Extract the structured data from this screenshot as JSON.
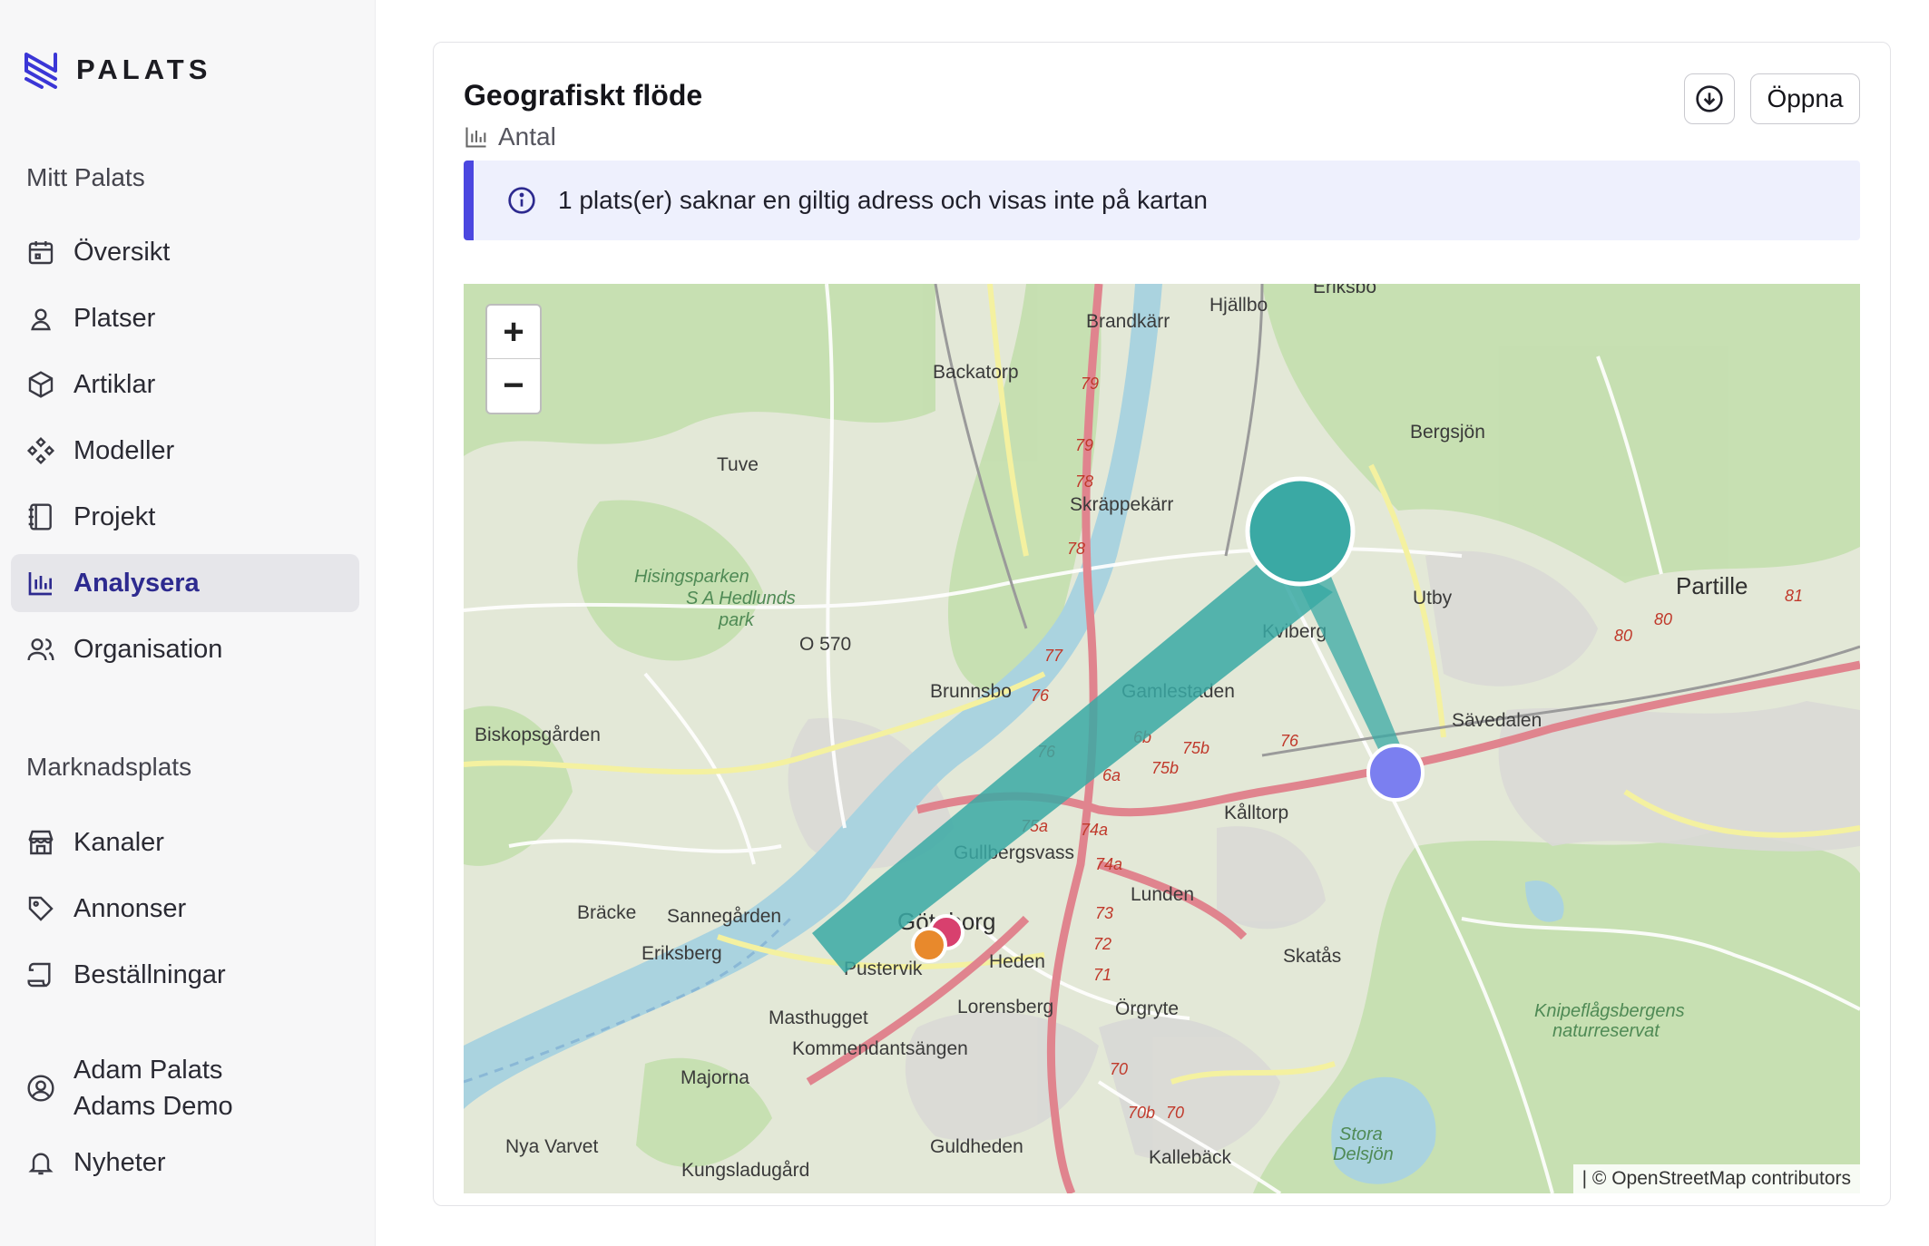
{
  "brand": {
    "name": "PALATS",
    "accent": "#3b36d6"
  },
  "sidebar": {
    "section_main": "Mitt Palats",
    "items": [
      {
        "label": "Översikt",
        "icon": "calendar-icon"
      },
      {
        "label": "Platser",
        "icon": "map-pin-icon"
      },
      {
        "label": "Artiklar",
        "icon": "box-icon"
      },
      {
        "label": "Modeller",
        "icon": "components-icon"
      },
      {
        "label": "Projekt",
        "icon": "notebook-icon"
      },
      {
        "label": "Analysera",
        "icon": "bar-chart-icon",
        "active": true
      },
      {
        "label": "Organisation",
        "icon": "users-icon"
      }
    ],
    "section_market": "Marknadsplats",
    "market_items": [
      {
        "label": "Kanaler",
        "icon": "store-icon"
      },
      {
        "label": "Annonser",
        "icon": "tag-icon"
      },
      {
        "label": "Beställningar",
        "icon": "scroll-icon"
      }
    ],
    "user": {
      "name": "Adam Palats",
      "org": "Adams Demo",
      "icon": "user-circle-icon"
    },
    "news": {
      "label": "Nyheter",
      "icon": "bell-icon"
    }
  },
  "card": {
    "title": "Geografiskt flöde",
    "subtitle": "Antal",
    "subtitle_icon": "bar-chart-icon",
    "download_icon": "download-circle-icon",
    "open_label": "Öppna",
    "info_text": "1 plats(er) saknar en giltig adress och visas inte på kartan",
    "info_icon": "info-icon"
  },
  "map": {
    "zoom_in": "+",
    "zoom_out": "−",
    "attribution": "| © OpenStreetMap contributors",
    "place_labels": [
      "Eriksbo",
      "Hjällbo",
      "Brandkärr",
      "Backatorp",
      "Bergsjön",
      "Tuve",
      "Skräppekärr",
      "Partille",
      "Utby",
      "Hisingsparken",
      "S A Hedlunds park",
      "O 570",
      "Kviberg",
      "Brunnsbo",
      "Gamlestaden",
      "Sävedalen",
      "Biskopsgården",
      "Kålltorp",
      "Gullbergsvass",
      "Lunden",
      "Bräcke",
      "Sannegården",
      "Göteborg",
      "Eriksberg",
      "Heden",
      "Skatås",
      "Pustervik",
      "Lorensberg",
      "Örgryte",
      "Masthugget",
      "Kommendantsängen",
      "Knipeflågsbergens naturreservat",
      "Majorna",
      "Nya Varvet",
      "Kungsladugård",
      "Guldheden",
      "Kallebäck",
      "Stora Delsjön"
    ],
    "road_numbers": [
      "79",
      "79",
      "78",
      "78",
      "77",
      "76",
      "76",
      "76",
      "75b",
      "75b",
      "6b",
      "6a",
      "75a",
      "74a",
      "74a",
      "73",
      "72",
      "71",
      "70",
      "70b",
      "70",
      "80",
      "80",
      "81"
    ],
    "colors": {
      "teal": "#3aa9a4",
      "violet": "#7b7ff0",
      "pink": "#d8406e",
      "orange": "#e8892c"
    }
  }
}
